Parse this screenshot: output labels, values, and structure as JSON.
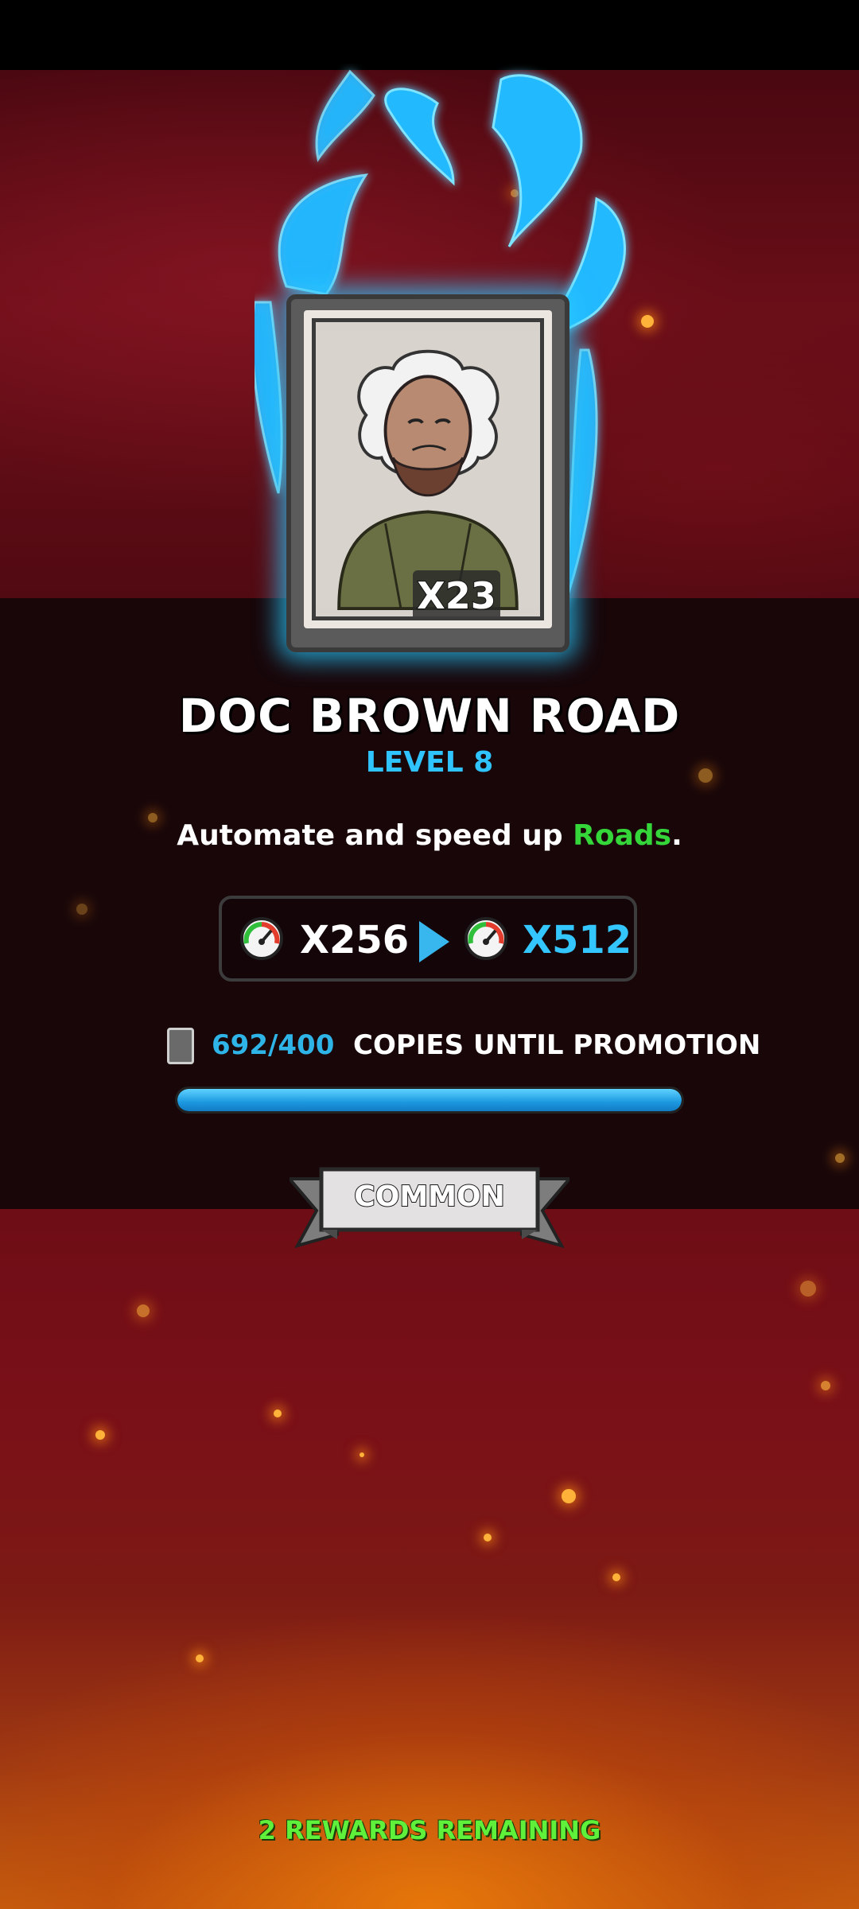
{
  "card": {
    "count": "X23",
    "name": "DOC BROWN ROAD",
    "level": "LEVEL 8",
    "description_prefix": "Automate and speed up ",
    "description_highlight": "Roads",
    "description_suffix": "."
  },
  "upgrade": {
    "current_multiplier": "X256",
    "next_multiplier": "X512",
    "icon": "speedometer-icon"
  },
  "promotion": {
    "copies_count": "692/400",
    "copies_label": "COPIES UNTIL PROMOTION",
    "progress_fraction": 1.0
  },
  "rarity": "COMMON",
  "rewards_remaining": "2 REWARDS REMAINING",
  "colors": {
    "accent_blue": "#34c6ff",
    "highlight_green": "#35d63a",
    "rewards_green": "#5ef03a"
  }
}
